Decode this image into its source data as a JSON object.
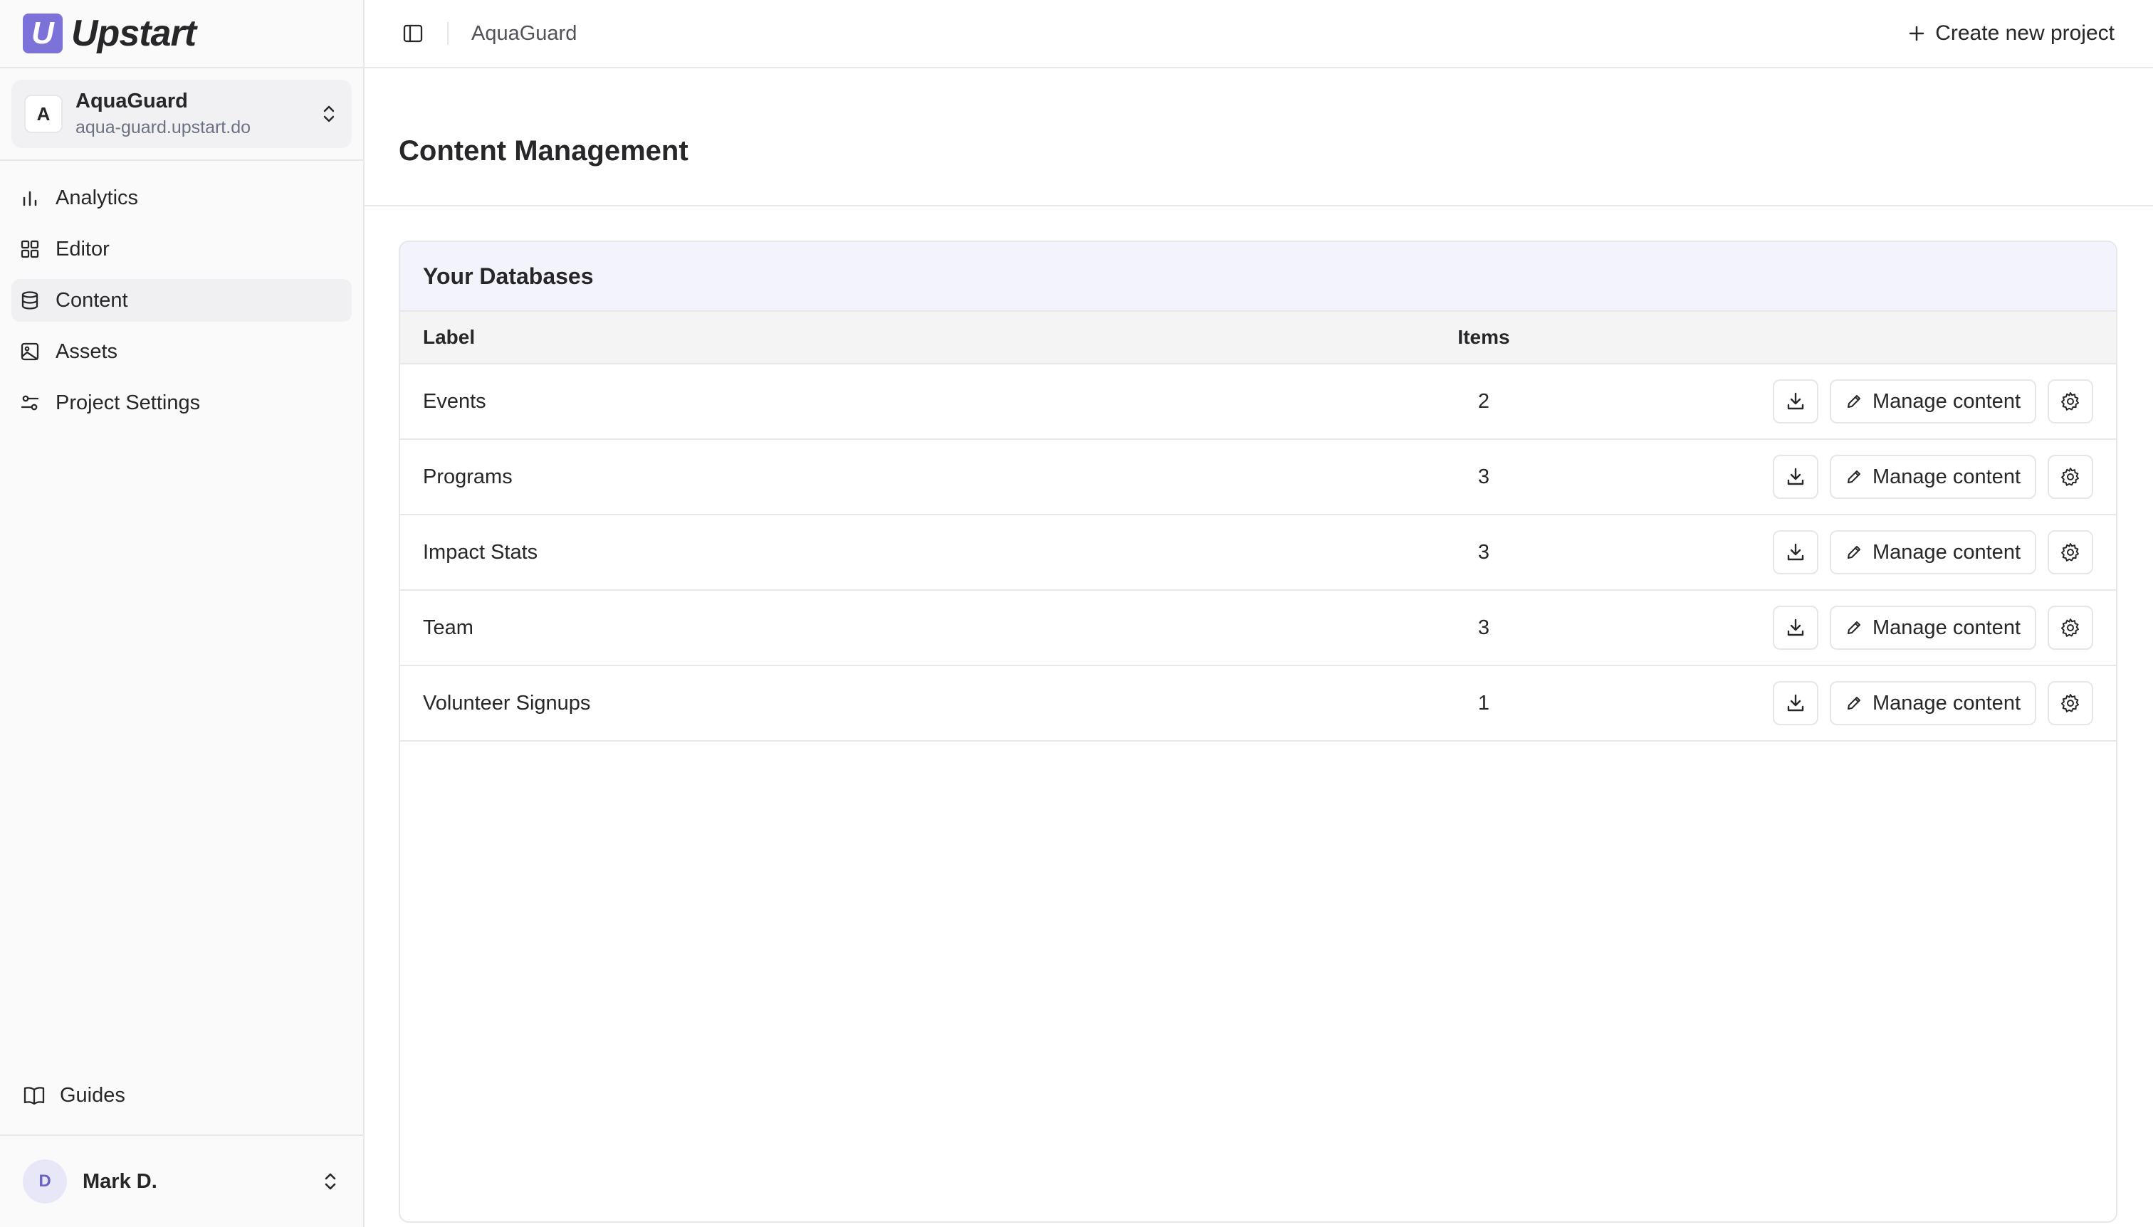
{
  "brand": {
    "name": "Upstart",
    "mark": "U"
  },
  "project": {
    "initial": "A",
    "name": "AquaGuard",
    "url": "aqua-guard.upstart.do"
  },
  "nav": [
    {
      "label": "Analytics",
      "icon": "bar-chart-icon"
    },
    {
      "label": "Editor",
      "icon": "grid-icon"
    },
    {
      "label": "Content",
      "icon": "database-icon",
      "active": true
    },
    {
      "label": "Assets",
      "icon": "image-icon"
    },
    {
      "label": "Project Settings",
      "icon": "sliders-icon"
    }
  ],
  "guides_label": "Guides",
  "user": {
    "initial": "D",
    "name": "Mark D."
  },
  "topbar": {
    "breadcrumb": "AquaGuard",
    "create_label": "Create new project"
  },
  "page": {
    "title": "Content Management"
  },
  "databases": {
    "title": "Your Databases",
    "columns": {
      "label": "Label",
      "items": "Items"
    },
    "manage_label": "Manage content",
    "rows": [
      {
        "label": "Events",
        "items": "2"
      },
      {
        "label": "Programs",
        "items": "3"
      },
      {
        "label": "Impact Stats",
        "items": "3"
      },
      {
        "label": "Team",
        "items": "3"
      },
      {
        "label": "Volunteer Signups",
        "items": "1"
      }
    ]
  },
  "colors": {
    "accent": "#7c72d9",
    "sidebar_bg": "#fafafa",
    "card_header_bg": "#f3f3fb"
  }
}
